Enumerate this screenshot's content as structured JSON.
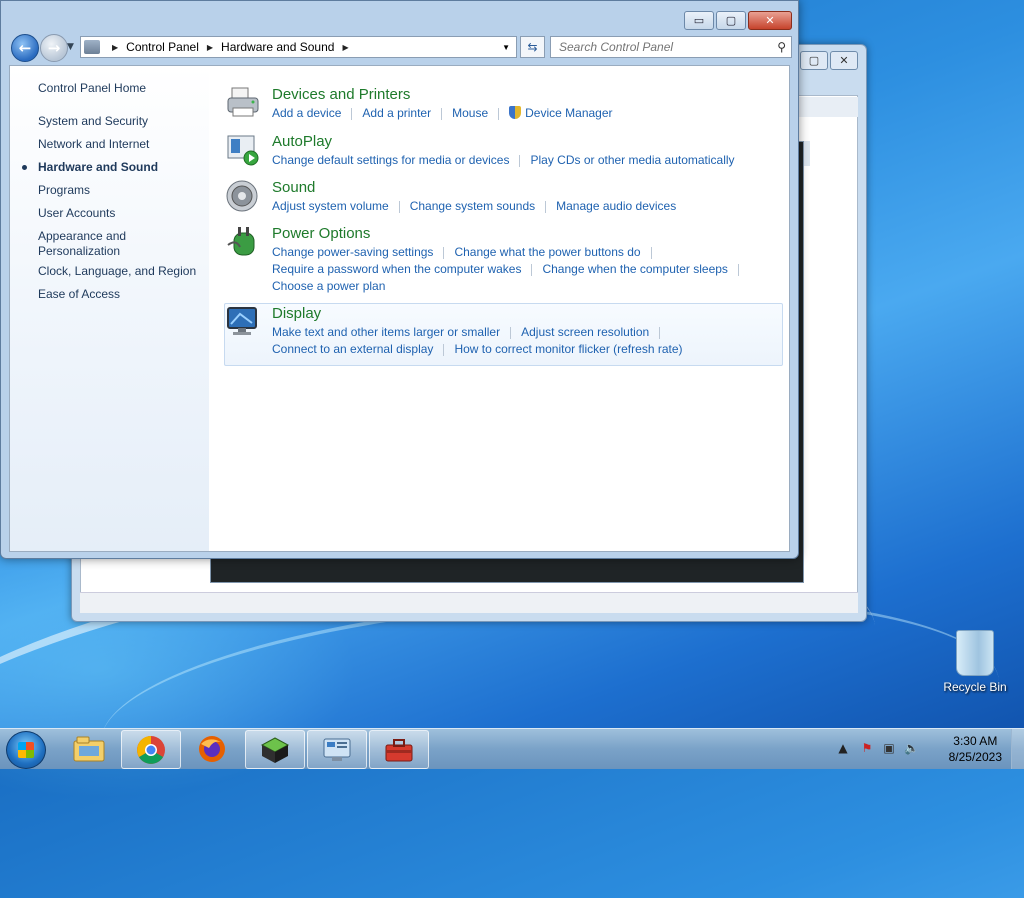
{
  "window": {
    "minimize": "▭",
    "maximize": "▢",
    "close": "✕"
  },
  "address": {
    "crumbs": [
      "Control Panel",
      "Hardware and Sound"
    ],
    "search_placeholder": "Search Control Panel"
  },
  "sidebar": {
    "items": [
      {
        "label": "Control Panel Home"
      },
      {
        "label": "System and Security"
      },
      {
        "label": "Network and Internet"
      },
      {
        "label": "Hardware and Sound",
        "active": true
      },
      {
        "label": "Programs"
      },
      {
        "label": "User Accounts"
      },
      {
        "label": "Appearance and Personalization"
      },
      {
        "label": "Clock, Language, and Region"
      },
      {
        "label": "Ease of Access"
      }
    ]
  },
  "categories": [
    {
      "title": "Devices and Printers",
      "icon": "printer-icon",
      "links": [
        [
          "Add a device",
          "Add a printer",
          "Mouse",
          "Device Manager"
        ]
      ]
    },
    {
      "title": "AutoPlay",
      "icon": "autoplay-icon",
      "links": [
        [
          "Change default settings for media or devices",
          "Play CDs or other media automatically"
        ]
      ]
    },
    {
      "title": "Sound",
      "icon": "speaker-icon",
      "links": [
        [
          "Adjust system volume",
          "Change system sounds",
          "Manage audio devices"
        ]
      ]
    },
    {
      "title": "Power Options",
      "icon": "power-icon",
      "links": [
        [
          "Change power-saving settings",
          "Change what the power buttons do"
        ],
        [
          "Require a password when the computer wakes",
          "Change when the computer sleeps"
        ],
        [
          "Choose a power plan"
        ]
      ]
    },
    {
      "title": "Display",
      "icon": "monitor-icon",
      "links": [
        [
          "Make text and other items larger or smaller",
          "Adjust screen resolution"
        ],
        [
          "Connect to an external display",
          "How to correct monitor flicker (refresh rate)"
        ]
      ]
    }
  ],
  "desktop": {
    "recycle_bin": "Recycle Bin"
  },
  "taskbar": {
    "apps": [
      "explorer-icon",
      "chrome-icon",
      "firefox-icon",
      "package-icon",
      "control-panel-icon",
      "toolbox-icon"
    ],
    "clock_time": "3:30 AM",
    "clock_date": "8/25/2023"
  }
}
